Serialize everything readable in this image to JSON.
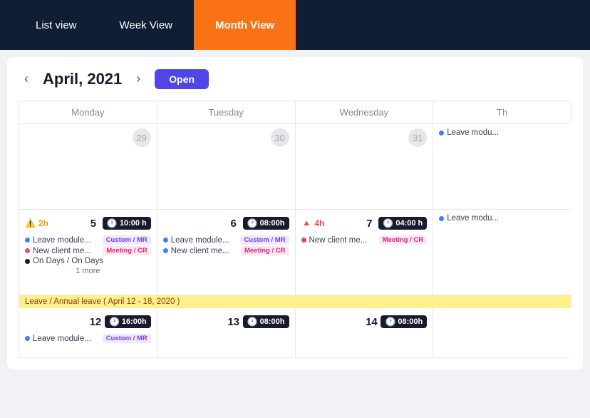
{
  "nav": {
    "tabs": [
      {
        "label": "List view",
        "active": false
      },
      {
        "label": "Week View",
        "active": false
      },
      {
        "label": "Month View",
        "active": true
      }
    ]
  },
  "header": {
    "prev_btn": "‹",
    "next_btn": "›",
    "title": "April, 2021",
    "open_btn": "Open"
  },
  "day_headers": [
    "Monday",
    "Tuesday",
    "Wednesday",
    "Th"
  ],
  "row1": {
    "cells": [
      {
        "date": "29",
        "greyed": true,
        "events": []
      },
      {
        "date": "30",
        "greyed": true,
        "events": []
      },
      {
        "date": "31",
        "greyed": true,
        "events": []
      },
      {
        "date": "",
        "greyed": true,
        "partial": true,
        "events": [
          {
            "dot": "blue",
            "label": "Leave modu..."
          }
        ]
      }
    ]
  },
  "row2": {
    "cells": [
      {
        "date": "5",
        "alert": {
          "type": "warning",
          "label": "2h"
        },
        "time": "10:00 h",
        "events": [
          {
            "dot": "blue",
            "label": "Leave module...",
            "tag": "Custom / MR"
          },
          {
            "dot": "pink",
            "label": "New client me...",
            "tag": "Meeting / CR"
          },
          {
            "dot": "black",
            "label": "On Days / On Days"
          }
        ],
        "more": "1 more"
      },
      {
        "date": "6",
        "time": "08:00h",
        "events": [
          {
            "dot": "blue",
            "label": "Leave module...",
            "tag": "Custom / MR"
          },
          {
            "dot": "blue",
            "label": "New client me...",
            "tag": "Meeting / CR"
          }
        ]
      },
      {
        "date": "7",
        "alert": {
          "type": "error",
          "label": "4h"
        },
        "time": "04:00 h",
        "events": [
          {
            "dot": "red",
            "label": "New client me...",
            "tag": "Meeting / CR"
          }
        ]
      },
      {
        "date": "",
        "partial": true,
        "events": [
          {
            "dot": "blue",
            "label": "Leave modu..."
          }
        ]
      }
    ]
  },
  "row3": {
    "annual_leave": "Leave / Annual leave ( April 12 - 18, 2020 )",
    "cells": [
      {
        "date": "12",
        "time": "16:00h",
        "events": [
          {
            "dot": "blue",
            "label": "Leave module...",
            "tag": "Custom / MR"
          }
        ]
      },
      {
        "date": "13",
        "time": "08:00h",
        "events": []
      },
      {
        "date": "14",
        "time": "08:00h",
        "events": []
      },
      {
        "date": "",
        "partial": true,
        "events": []
      }
    ]
  }
}
